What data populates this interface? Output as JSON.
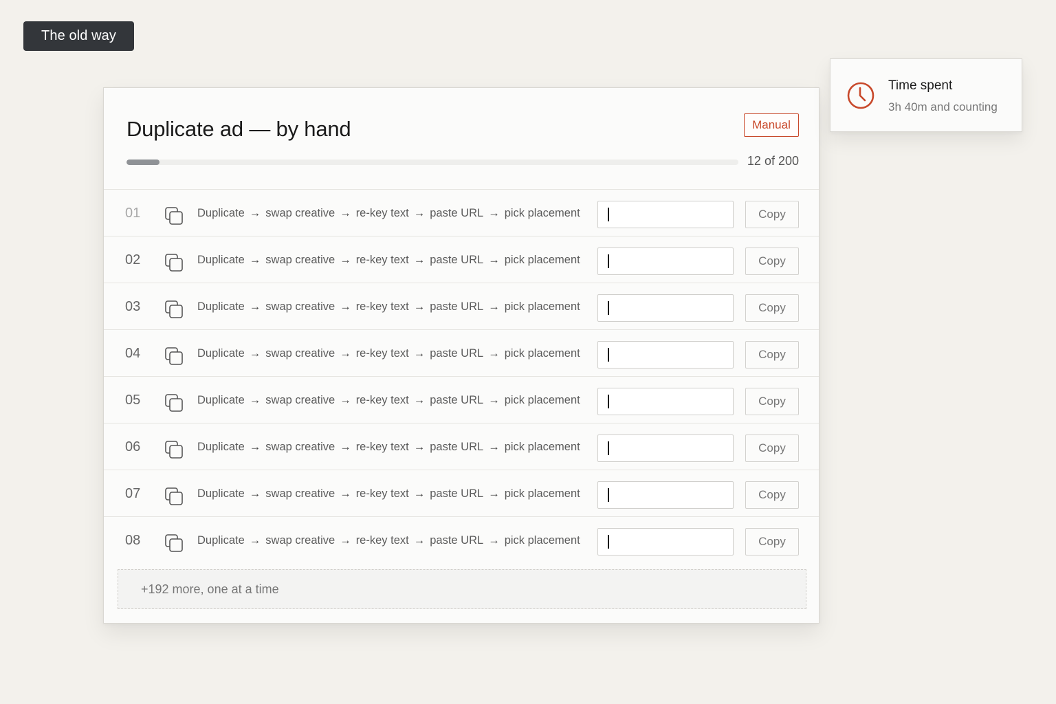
{
  "tag": {
    "label": "The old way"
  },
  "card": {
    "title": "Duplicate ad — by hand",
    "badge": "Manual",
    "progress": {
      "done": 12,
      "total": 200,
      "label": "12 of 200"
    },
    "rows": [
      {
        "num": "01",
        "steps": [
          "Duplicate",
          "swap creative",
          "re-key text",
          "paste URL",
          "pick placement"
        ],
        "button": "Copy"
      },
      {
        "num": "02",
        "steps": [
          "Duplicate",
          "swap creative",
          "re-key text",
          "paste URL",
          "pick placement"
        ],
        "button": "Copy"
      },
      {
        "num": "03",
        "steps": [
          "Duplicate",
          "swap creative",
          "re-key text",
          "paste URL",
          "pick placement"
        ],
        "button": "Copy"
      },
      {
        "num": "04",
        "steps": [
          "Duplicate",
          "swap creative",
          "re-key text",
          "paste URL",
          "pick placement"
        ],
        "button": "Copy"
      },
      {
        "num": "05",
        "steps": [
          "Duplicate",
          "swap creative",
          "re-key text",
          "paste URL",
          "pick placement"
        ],
        "button": "Copy"
      },
      {
        "num": "06",
        "steps": [
          "Duplicate",
          "swap creative",
          "re-key text",
          "paste URL",
          "pick placement"
        ],
        "button": "Copy"
      },
      {
        "num": "07",
        "steps": [
          "Duplicate",
          "swap creative",
          "re-key text",
          "paste URL",
          "pick placement"
        ],
        "button": "Copy"
      },
      {
        "num": "08",
        "steps": [
          "Duplicate",
          "swap creative",
          "re-key text",
          "paste URL",
          "pick placement"
        ],
        "button": "Copy"
      }
    ],
    "step_separator": "→",
    "row_icon": "duplicate-icon",
    "more": "+192 more, one at a time"
  },
  "timer": {
    "icon": "clock-icon",
    "title": "Time spent",
    "subtitle": "3h 40m and counting"
  },
  "colors": {
    "background": "#f3f1ec",
    "accent": "#c8492b",
    "tag_bg": "#33363a",
    "progress_fill": "#8f9296"
  }
}
